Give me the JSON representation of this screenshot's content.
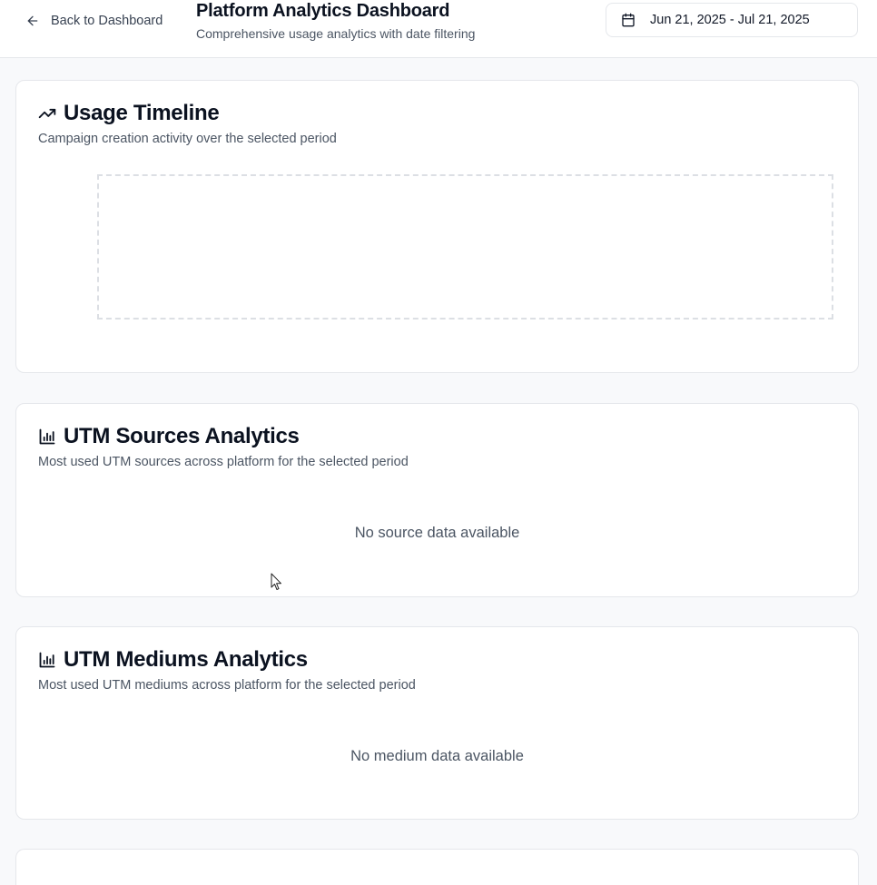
{
  "header": {
    "back_label": "Back to Dashboard",
    "title": "Platform Analytics Dashboard",
    "subtitle": "Comprehensive usage analytics with date filtering",
    "date_range": "Jun 21, 2025 - Jul 21, 2025"
  },
  "cards": {
    "timeline": {
      "title": "Usage Timeline",
      "description": "Campaign creation activity over the selected period",
      "icon": "trending-up-icon"
    },
    "sources": {
      "title": "UTM Sources Analytics",
      "description": "Most used UTM sources across platform for the selected period",
      "empty": "No source data available",
      "icon": "bar-chart-icon"
    },
    "mediums": {
      "title": "UTM Mediums Analytics",
      "description": "Most used UTM mediums across platform for the selected period",
      "empty": "No medium data available",
      "icon": "bar-chart-icon"
    }
  },
  "colors": {
    "background": "#f8f9fb",
    "card": "#ffffff",
    "border": "#e5e7eb",
    "text_primary": "#0b1220",
    "text_muted": "#4b5563"
  }
}
